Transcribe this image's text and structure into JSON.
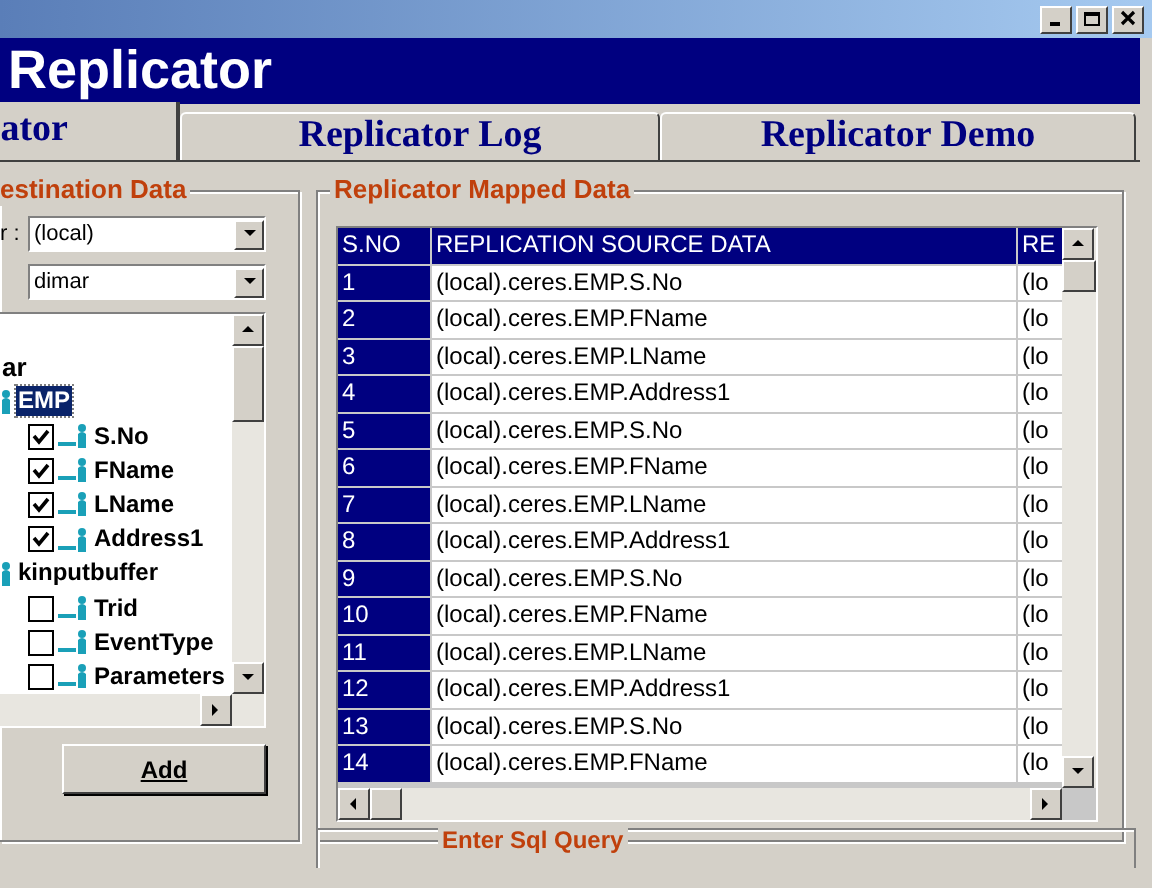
{
  "banner": {
    "title": "Replicator"
  },
  "tabs": [
    {
      "label": "ator",
      "selected": true
    },
    {
      "label": "Replicator Log",
      "selected": false
    },
    {
      "label": "Replicator Demo",
      "selected": false
    }
  ],
  "destination": {
    "title": "estination Data",
    "server_label": "r :",
    "server": "(local)",
    "database": "dimar",
    "tree": [
      {
        "kind": "database",
        "label": "ar",
        "children": [
          {
            "kind": "table",
            "label": "EMP",
            "selected": true,
            "children": [
              {
                "kind": "column",
                "label": "S.No",
                "checked": true
              },
              {
                "kind": "column",
                "label": "FName",
                "checked": true
              },
              {
                "kind": "column",
                "label": "LName",
                "checked": true
              },
              {
                "kind": "column",
                "label": "Address1",
                "checked": true
              }
            ]
          },
          {
            "kind": "table",
            "label": "kinputbuffer",
            "selected": false,
            "children": [
              {
                "kind": "column",
                "label": "Trid",
                "checked": false
              },
              {
                "kind": "column",
                "label": "EventType",
                "checked": false
              },
              {
                "kind": "column",
                "label": "Parameters",
                "checked": false
              }
            ]
          }
        ]
      }
    ],
    "add_button": "Add"
  },
  "mapped": {
    "title": "Replicator Mapped Data",
    "columns": [
      "S.NO",
      "REPLICATION SOURCE DATA",
      "RE"
    ],
    "rows": [
      [
        "1",
        "(local).ceres.EMP.S.No",
        "(lo"
      ],
      [
        "2",
        "(local).ceres.EMP.FName",
        "(lo"
      ],
      [
        "3",
        "(local).ceres.EMP.LName",
        "(lo"
      ],
      [
        "4",
        "(local).ceres.EMP.Address1",
        "(lo"
      ],
      [
        "5",
        "(local).ceres.EMP.S.No",
        "(lo"
      ],
      [
        "6",
        "(local).ceres.EMP.FName",
        "(lo"
      ],
      [
        "7",
        "(local).ceres.EMP.LName",
        "(lo"
      ],
      [
        "8",
        "(local).ceres.EMP.Address1",
        "(lo"
      ],
      [
        "9",
        "(local).ceres.EMP.S.No",
        "(lo"
      ],
      [
        "10",
        "(local).ceres.EMP.FName",
        "(lo"
      ],
      [
        "11",
        "(local).ceres.EMP.LName",
        "(lo"
      ],
      [
        "12",
        "(local).ceres.EMP.Address1",
        "(lo"
      ],
      [
        "13",
        "(local).ceres.EMP.S.No",
        "(lo"
      ],
      [
        "14",
        "(local).ceres.EMP.FName",
        "(lo"
      ]
    ]
  },
  "query": {
    "title": "Enter Sql Query"
  }
}
